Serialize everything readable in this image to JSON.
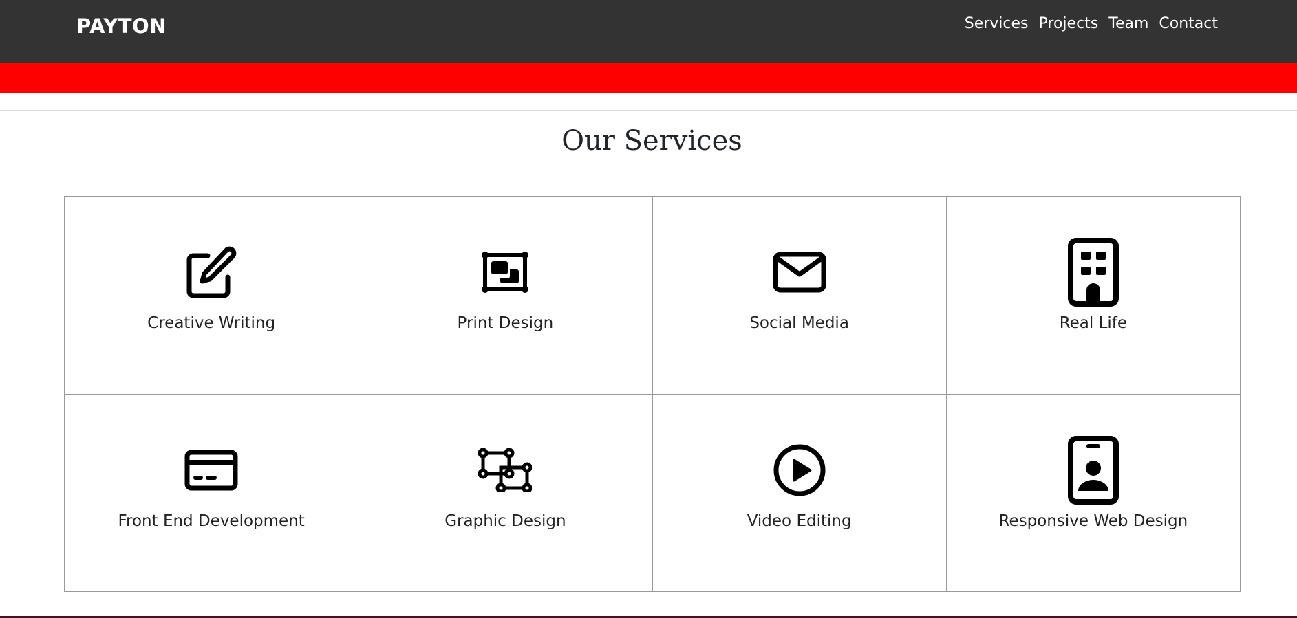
{
  "navbar": {
    "brand": "PAYTON",
    "links": [
      "Services",
      "Projects",
      "Team",
      "Contact"
    ]
  },
  "section": {
    "title": "Our Services"
  },
  "services": [
    {
      "label": "Creative Writing",
      "icon": "pencil-square-icon"
    },
    {
      "label": "Print Design",
      "icon": "print-layout-icon"
    },
    {
      "label": "Social Media",
      "icon": "envelope-icon"
    },
    {
      "label": "Real Life",
      "icon": "building-icon"
    },
    {
      "label": "Front End Development",
      "icon": "credit-card-icon"
    },
    {
      "label": "Graphic Design",
      "icon": "vector-shapes-icon"
    },
    {
      "label": "Video Editing",
      "icon": "play-circle-icon"
    },
    {
      "label": "Responsive Web Design",
      "icon": "id-badge-icon"
    }
  ],
  "colors": {
    "navbar_bg": "#333333",
    "accent_band": "#ff0000",
    "footer_accent": "#4a0f1f"
  }
}
